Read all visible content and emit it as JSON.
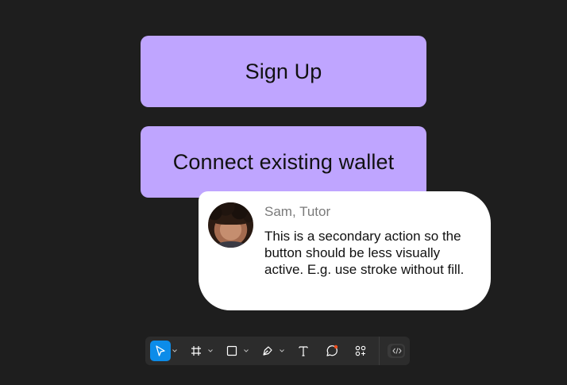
{
  "buttons": {
    "primary_label": "Sign Up",
    "secondary_label": "Connect existing wallet"
  },
  "comment": {
    "author": "Sam, Tutor",
    "message": "This is a secondary action so the button should be less visually active. E.g. use stroke without fill."
  },
  "toolbar": {
    "tools": [
      {
        "name": "move-tool",
        "icon": "cursor-arrow-icon",
        "active": true,
        "has_menu": true
      },
      {
        "name": "frame-tool",
        "icon": "frame-hash-icon",
        "active": false,
        "has_menu": true
      },
      {
        "name": "shape-tool",
        "icon": "rectangle-icon",
        "active": false,
        "has_menu": true
      },
      {
        "name": "pen-tool",
        "icon": "pen-nib-icon",
        "active": false,
        "has_menu": true
      },
      {
        "name": "text-tool",
        "icon": "text-t-icon",
        "active": false,
        "has_menu": false
      },
      {
        "name": "comment-tool",
        "icon": "comment-bubble-icon",
        "active": false,
        "has_menu": false
      },
      {
        "name": "resources-tool",
        "icon": "components-icon",
        "active": false,
        "has_menu": false
      }
    ],
    "dev_mode_icon": "code-brackets-icon"
  },
  "colors": {
    "canvas_bg": "#1e1e1e",
    "button_fill": "#bfa5ff",
    "toolbar_bg": "#2c2c2c",
    "active_tool": "#0c8ce9",
    "comment_notification_dot": "#f24e1e"
  }
}
